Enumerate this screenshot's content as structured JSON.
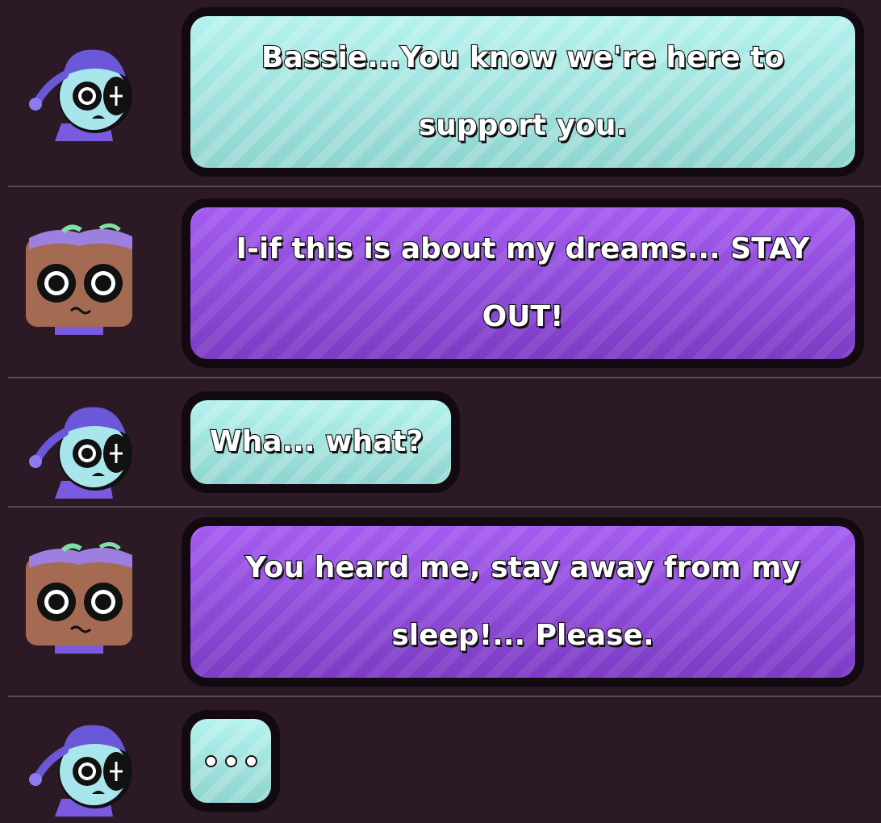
{
  "messages": [
    {
      "speaker": "blue",
      "style": "teal",
      "text_line1": "Bassie...You know we're here to",
      "text_line2": "support you."
    },
    {
      "speaker": "brown",
      "style": "purple",
      "text_line1": "I-if this is about my dreams... STAY",
      "text_line2": "OUT!"
    },
    {
      "speaker": "blue",
      "style": "teal",
      "text_line1": "Wha... what?"
    },
    {
      "speaker": "brown",
      "style": "purple",
      "text_line1": "You heard me, stay away from my",
      "text_line2": "sleep!... Please."
    },
    {
      "speaker": "blue",
      "style": "teal",
      "typing_icon": "ellipsis-dots"
    }
  ],
  "colors": {
    "background": "#2b1a26",
    "teal_bubble": "#a6e6e2",
    "purple_bubble": "#9450e0",
    "divider": "#5c4856"
  }
}
